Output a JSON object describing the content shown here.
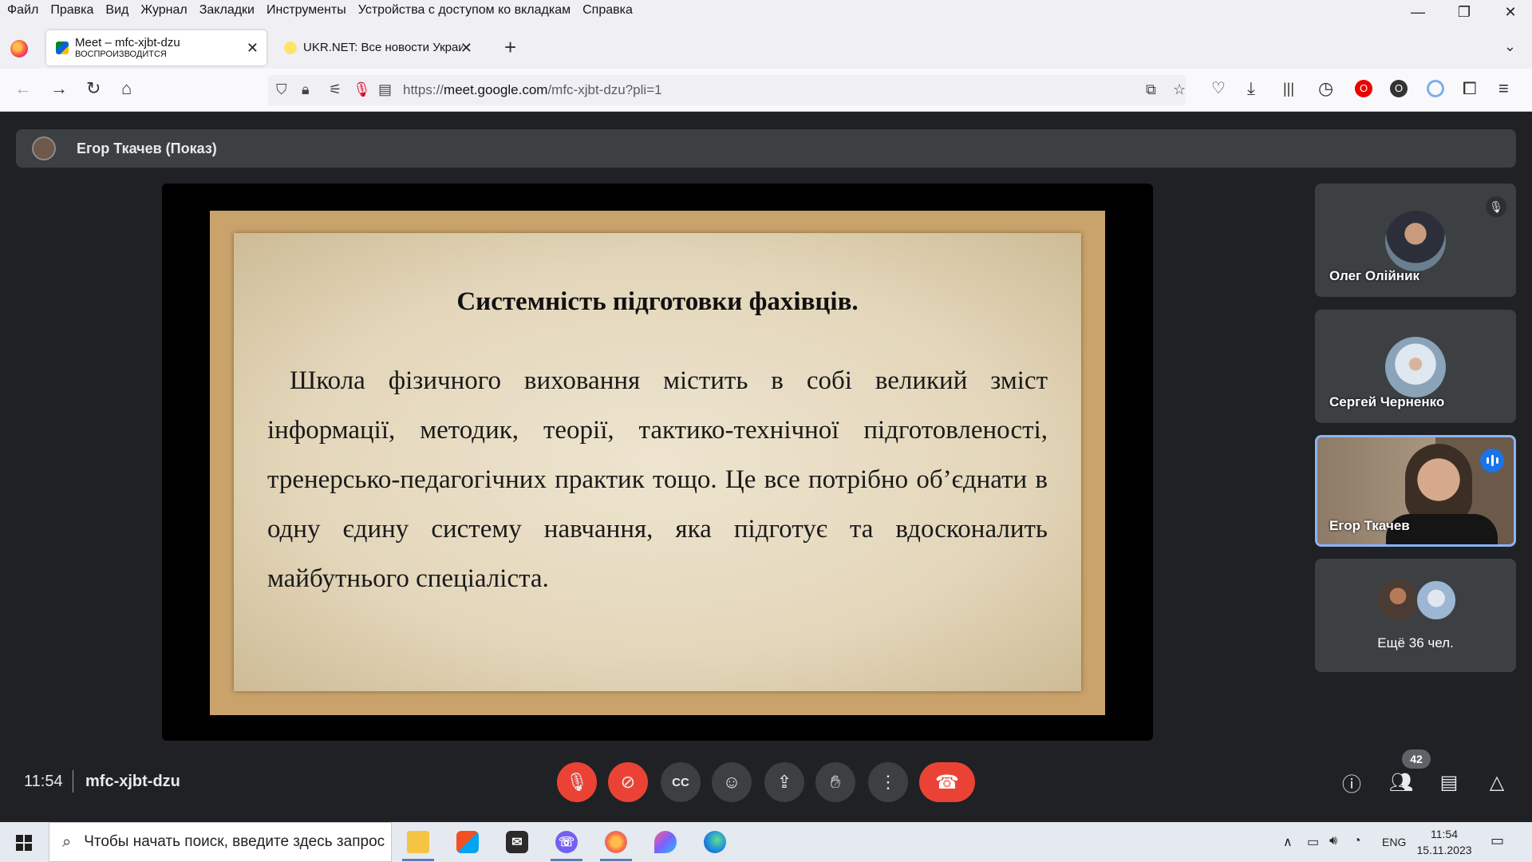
{
  "menu": [
    "Файл",
    "Правка",
    "Вид",
    "Журнал",
    "Закладки",
    "Инструменты",
    "Устройства с доступом ко вкладкам",
    "Справка"
  ],
  "window_controls": {
    "minimize": "—",
    "restore": "❐",
    "close": "✕"
  },
  "tabs": [
    {
      "title": "Meet – mfc-xjbt-dzu",
      "subtitle": "ВОСПРОИЗВОДИТСЯ",
      "active": true
    },
    {
      "title": "UKR.NET: Все новости Украины",
      "active": false
    }
  ],
  "url": {
    "prefix": "https://",
    "host": "meet.google.com",
    "path": "/mfc-xjbt-dzu?pli=1"
  },
  "presenter": {
    "label": "Егор Ткачев (Показ)"
  },
  "slide": {
    "title": "Системність підготовки фахівців.",
    "body": "Школа фізичного виховання містить в собі великий зміст інформації, методик, теорії, тактико-технічної підготовленості, тренерсько-педагогічних практик тощо. Це все потрібно об’єднати в одну єдину систему навчання, яка підготує та вдосконалить майбутнього спеціаліста."
  },
  "participants": [
    {
      "name": "Олег Олійник",
      "muted": true
    },
    {
      "name": "Сергей Черненко",
      "muted": false
    },
    {
      "name": "Егор Ткачев",
      "speaking": true
    },
    {
      "name": "Ещё 36 чел."
    }
  ],
  "meeting": {
    "time": "11:54",
    "code": "mfc-xjbt-dzu",
    "participant_count": "42"
  },
  "colors": {
    "meet_bg": "#202124",
    "tile_bg": "#3c4043",
    "red": "#ea4335",
    "accent": "#1a73e8"
  },
  "taskbar": {
    "search_placeholder": "Чтобы начать поиск, введите здесь запрос",
    "language": "ENG",
    "time": "11:54",
    "date": "15.11.2023"
  }
}
